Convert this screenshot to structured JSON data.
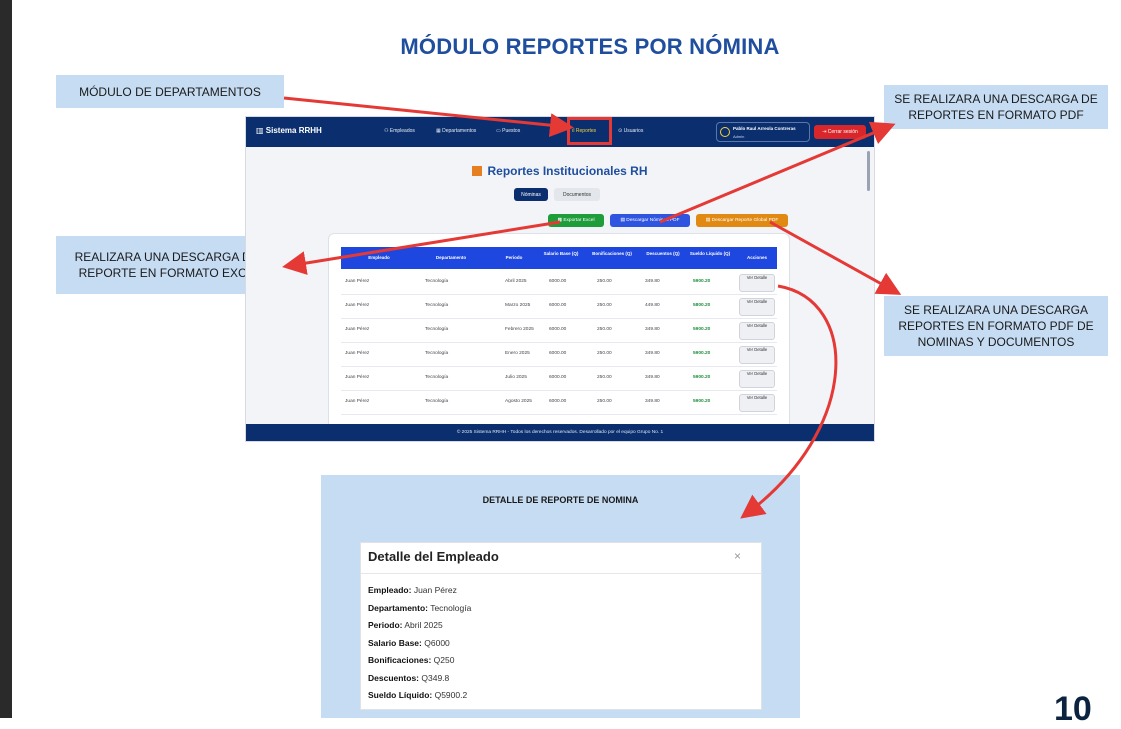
{
  "slide": {
    "title": "MÓDULO REPORTES POR NÓMINA",
    "page_number": "10"
  },
  "callouts": {
    "departamentos": "MÓDULO DE DEPARTAMENTOS",
    "pdf_download": "SE REALIZARA UNA DESCARGA DE REPORTES EN FORMATO PDF",
    "excel_download": "REALIZARA UNA DESCARGA DEL REPORTE EN FORMATO EXCEL",
    "pdf_global": "SE REALIZARA UNA DESCARGA REPORTES EN FORMATO PDF DE NOMINAS Y DOCUMENTOS"
  },
  "app": {
    "brand": "Sistema RRHH",
    "nav": [
      "Empleados",
      "Departamentos",
      "Puestos",
      "Reportes",
      "Usuarios"
    ],
    "user_name": "Pablo Raul Arreola Contreras",
    "user_role": "Admin",
    "logout": "Cerrar sesión",
    "page_title": "Reportes Institucionales RH",
    "tabs": [
      "Nóminas",
      "Documentos"
    ],
    "actions": {
      "excel": "Exportar Excel",
      "pdf_nominas": "Descargar Nóminas PDF",
      "pdf_global": "Descargar Reporte Global PDF"
    },
    "columns": [
      "Empleado",
      "Departamento",
      "Periodo",
      "Salario Base (Q)",
      "Bonificaciones (Q)",
      "Descuentos (Q)",
      "Sueldo Líquido (Q)",
      "Acciones"
    ],
    "rows": [
      {
        "empleado": "Juan Pérez",
        "departamento": "Tecnología",
        "periodo": "Abril 2025",
        "salario": "6000.00",
        "bonif": "250.00",
        "desc": "349.80",
        "liquido": "5900.20",
        "accion": "Ver Detalle"
      },
      {
        "empleado": "Juan Pérez",
        "departamento": "Tecnología",
        "periodo": "Marzo 2025",
        "salario": "6000.00",
        "bonif": "250.00",
        "desc": "449.80",
        "liquido": "5800.20",
        "accion": "Ver Detalle"
      },
      {
        "empleado": "Juan Pérez",
        "departamento": "Tecnología",
        "periodo": "Febrero 2025",
        "salario": "6000.00",
        "bonif": "250.00",
        "desc": "349.80",
        "liquido": "5900.20",
        "accion": "Ver Detalle"
      },
      {
        "empleado": "Juan Pérez",
        "departamento": "Tecnología",
        "periodo": "Enero 2025",
        "salario": "6000.00",
        "bonif": "250.00",
        "desc": "349.80",
        "liquido": "5900.20",
        "accion": "Ver Detalle"
      },
      {
        "empleado": "Juan Pérez",
        "departamento": "Tecnología",
        "periodo": "Julio 2025",
        "salario": "6000.00",
        "bonif": "250.00",
        "desc": "349.80",
        "liquido": "5900.20",
        "accion": "Ver Detalle"
      },
      {
        "empleado": "Juan Pérez",
        "departamento": "Tecnología",
        "periodo": "Agosto 2025",
        "salario": "6000.00",
        "bonif": "250.00",
        "desc": "349.80",
        "liquido": "5900.20",
        "accion": "Ver Detalle"
      }
    ],
    "footer": "© 2025 Sistema RRHH - Todos los derechos reservados. Desarrollado por el equipo Grupo No. 1"
  },
  "detail": {
    "section_title": "DETALLE DE REPORTE DE NOMINA",
    "modal_title": "Detalle del Empleado",
    "close": "×",
    "fields": [
      {
        "label": "Empleado:",
        "value": "Juan Pérez"
      },
      {
        "label": "Departamento:",
        "value": "Tecnología"
      },
      {
        "label": "Periodo:",
        "value": "Abril 2025"
      },
      {
        "label": "Salario Base:",
        "value": "Q6000"
      },
      {
        "label": "Bonificaciones:",
        "value": "Q250"
      },
      {
        "label": "Descuentos:",
        "value": "Q349.8"
      },
      {
        "label": "Sueldo Líquido:",
        "value": "Q5900.2"
      }
    ]
  },
  "colors": {
    "title_blue": "#1f4e9e",
    "navbar": "#0b2f6e",
    "callout_bg": "#c6dcf3",
    "arrow_red": "#e53935",
    "excel_green": "#1f9d3a",
    "pdf_blue": "#2f55e0",
    "pdf_orange": "#e08a14"
  }
}
